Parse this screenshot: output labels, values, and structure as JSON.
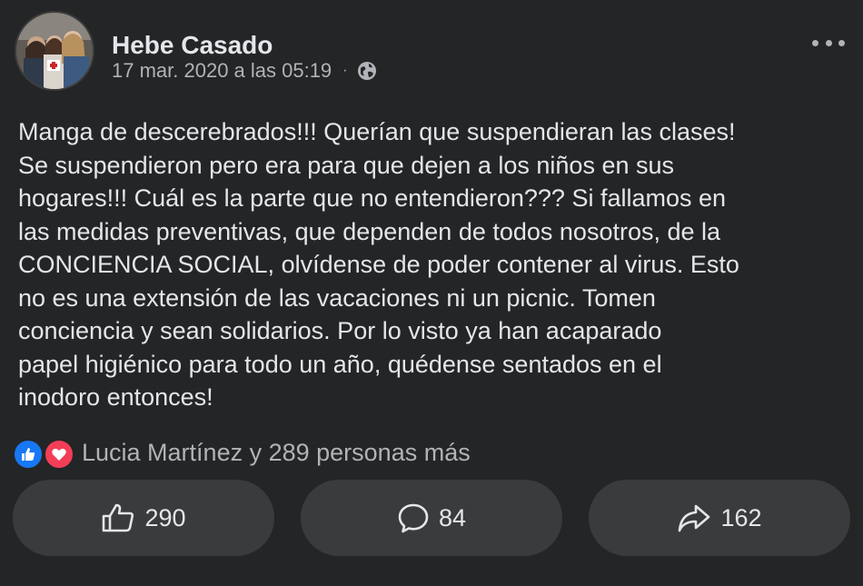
{
  "post": {
    "author": "Hebe Casado",
    "timestamp": "17 mar. 2020 a las 05:19",
    "separator": "·",
    "privacy_icon": "globe-icon",
    "more_icon": "more-options-icon",
    "text": "Manga de descerebrados!!! Querían que suspendieran las clases!\nSe suspendieron pero era para que dejen a los niños en sus\nhogares!!! Cuál es la parte que no entendieron??? Si fallamos en\nlas medidas preventivas, que dependen de todos nosotros, de la\nCONCIENCIA SOCIAL, olvídense de poder contener al virus. Esto\nno es una extensión de las vacaciones ni un picnic. Tomen\nconciencia y sean solidarios. Por lo visto ya han acaparado\npapel higiénico para todo un año, quédense sentados en el\ninodoro entonces!"
  },
  "reactions": {
    "icons": [
      "like-reaction-icon",
      "love-reaction-icon"
    ],
    "summary": "Lucia Martínez y 289 personas más"
  },
  "actions": {
    "like_count": "290",
    "comment_count": "84",
    "share_count": "162"
  },
  "colors": {
    "background": "#242526",
    "button": "#3a3b3c",
    "text_primary": "#e4e6eb",
    "text_secondary": "#b0b3b8",
    "like_blue": "#1877f2",
    "love_red": "#f33e58"
  }
}
